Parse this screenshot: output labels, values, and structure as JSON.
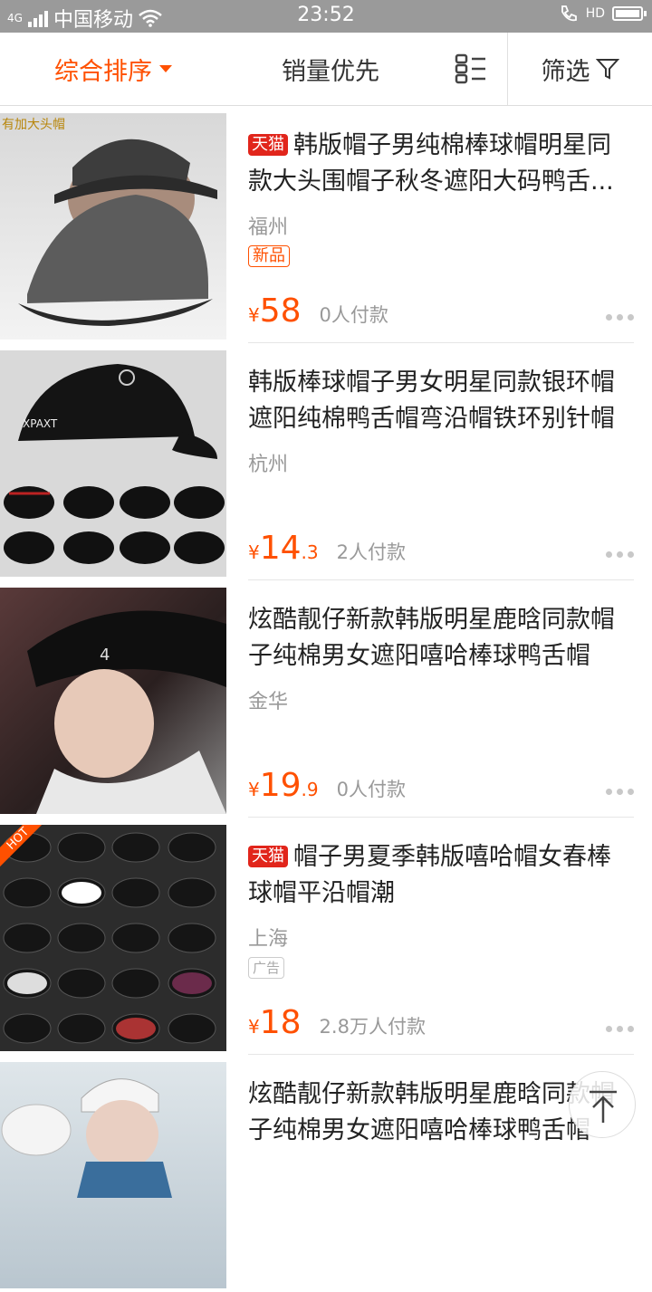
{
  "status": {
    "carrier": "中国移动",
    "network": "4G",
    "time": "23:52",
    "hd": "HD"
  },
  "sortbar": {
    "comprehensive": "综合排序",
    "sales": "销量优先",
    "filter": "筛选"
  },
  "colors": {
    "accent": "#ff5000",
    "tmall": "#e1251b"
  },
  "items": [
    {
      "tmall": "天猫",
      "title": "韩版帽子男纯棉棒球帽明星同款大头围帽子秋冬遮阳大码鸭舌...",
      "location": "福州",
      "badge": "新品",
      "price_int": "58",
      "price_dec": "",
      "sold": "0人付款",
      "thumb_text": "有加大头帽"
    },
    {
      "title": "韩版棒球帽子男女明星同款银环帽遮阳纯棉鸭舌帽弯沿帽铁环别针帽",
      "location": "杭州",
      "price_int": "14",
      "price_dec": ".3",
      "sold": "2人付款"
    },
    {
      "title": "炫酷靓仔新款韩版明星鹿晗同款帽子纯棉男女遮阳嘻哈棒球鸭舌帽",
      "location": "金华",
      "price_int": "19",
      "price_dec": ".9",
      "sold": "0人付款"
    },
    {
      "tmall": "天猫",
      "title": "帽子男夏季韩版嘻哈帽女春棒球帽平沿帽潮",
      "location": "上海",
      "badge": "广告",
      "price_int": "18",
      "price_dec": "",
      "sold": "2.8万人付款",
      "thumb_text": "HOT"
    },
    {
      "title": "炫酷靓仔新款韩版明星鹿晗同款帽子纯棉男女遮阳嘻哈棒球鸭舌帽"
    }
  ],
  "yen": "¥",
  "icons": {
    "layout": "list-grid-icon",
    "filter": "funnel-icon",
    "backtop": "arrow-up-icon"
  }
}
